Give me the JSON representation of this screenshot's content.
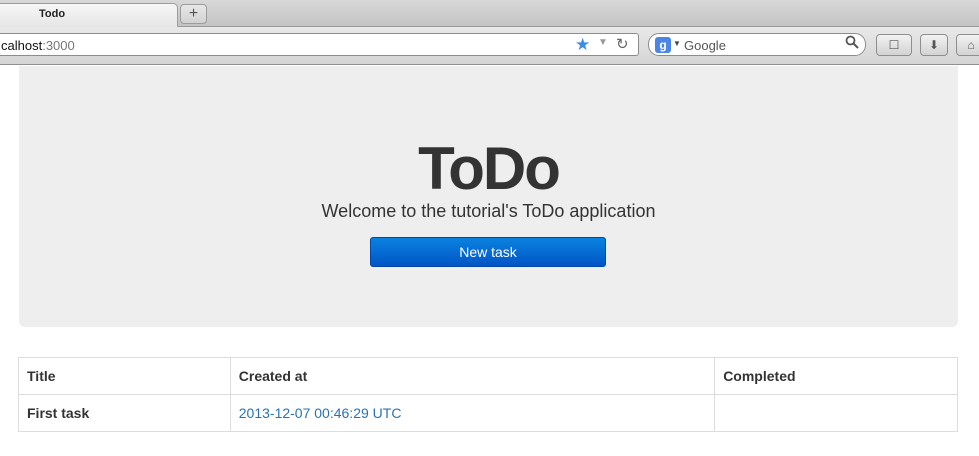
{
  "browser": {
    "tab_title": "Todo",
    "new_tab_label": "+",
    "url_host": "calhost",
    "url_rest": ":3000",
    "search_placeholder": "Google",
    "search_engine_letter": "g"
  },
  "icons": {
    "bookmark_star": "★",
    "dropdown": "▼",
    "reload": "↻",
    "magnifier": "⚲",
    "bookmarks_menu": "☐",
    "download": "⬇",
    "home": "⌂"
  },
  "jumbotron": {
    "heading": "ToDo",
    "lead": "Welcome to the tutorial's ToDo application",
    "button_label": "New task"
  },
  "table": {
    "headers": [
      "Title",
      "Created at",
      "Completed"
    ],
    "rows": [
      {
        "title": "First task",
        "created_at": "2013-12-07 00:46:29 UTC",
        "completed": ""
      }
    ]
  },
  "colors": {
    "button_primary": "#0066cc",
    "link": "#2a73b0",
    "jumbotron_bg": "#eeeeee"
  }
}
